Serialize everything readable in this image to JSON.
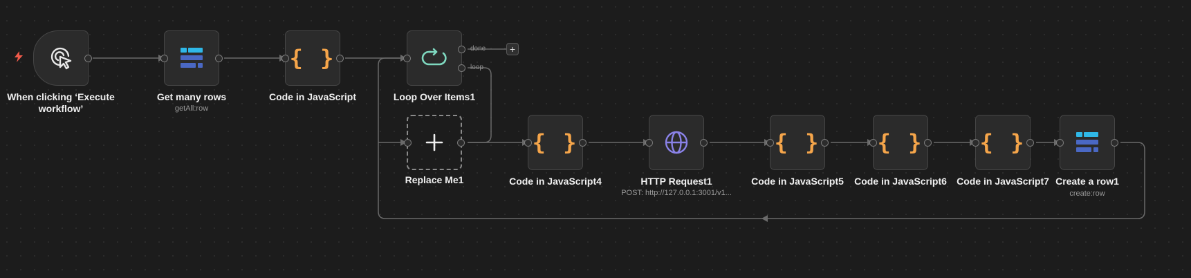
{
  "nodes": {
    "trigger": {
      "label": "When clicking ‘Execute workflow’"
    },
    "get_rows": {
      "label": "Get many rows",
      "subtitle": "getAll:row"
    },
    "code1": {
      "label": "Code in JavaScript"
    },
    "loop": {
      "label": "Loop Over Items1",
      "done_label": "done",
      "loop_label": "loop"
    },
    "replace": {
      "label": "Replace Me1"
    },
    "code4": {
      "label": "Code in JavaScript4"
    },
    "http": {
      "label": "HTTP Request1",
      "subtitle": "POST: http://127.0.0.1:3001/v1..."
    },
    "code5": {
      "label": "Code in JavaScript5"
    },
    "code6": {
      "label": "Code in JavaScript6"
    },
    "code7": {
      "label": "Code in JavaScript7"
    },
    "create_row": {
      "label": "Create a row1",
      "subtitle": "create:row"
    }
  },
  "glyphs": {
    "braces": "{ }",
    "plus": "+"
  },
  "icons": {
    "trigger": "cursor-click-icon",
    "get_rows": "table-icon",
    "code": "code-braces-icon",
    "loop": "loop-icon",
    "http": "globe-icon",
    "replace": "plus-icon",
    "create_row": "table-icon"
  },
  "colors": {
    "canvas": "#1c1c1c",
    "node_bg": "#2b2b2b",
    "node_border": "#464646",
    "code_icon": "#f5a54a",
    "table_icon_light": "#2fb8e8",
    "table_icon_dark": "#4a68c4",
    "loop_icon": "#7fd9c0",
    "http_icon": "#8a82e8",
    "trigger_bolt": "#f05a4a",
    "wire": "#6a6a6a"
  }
}
